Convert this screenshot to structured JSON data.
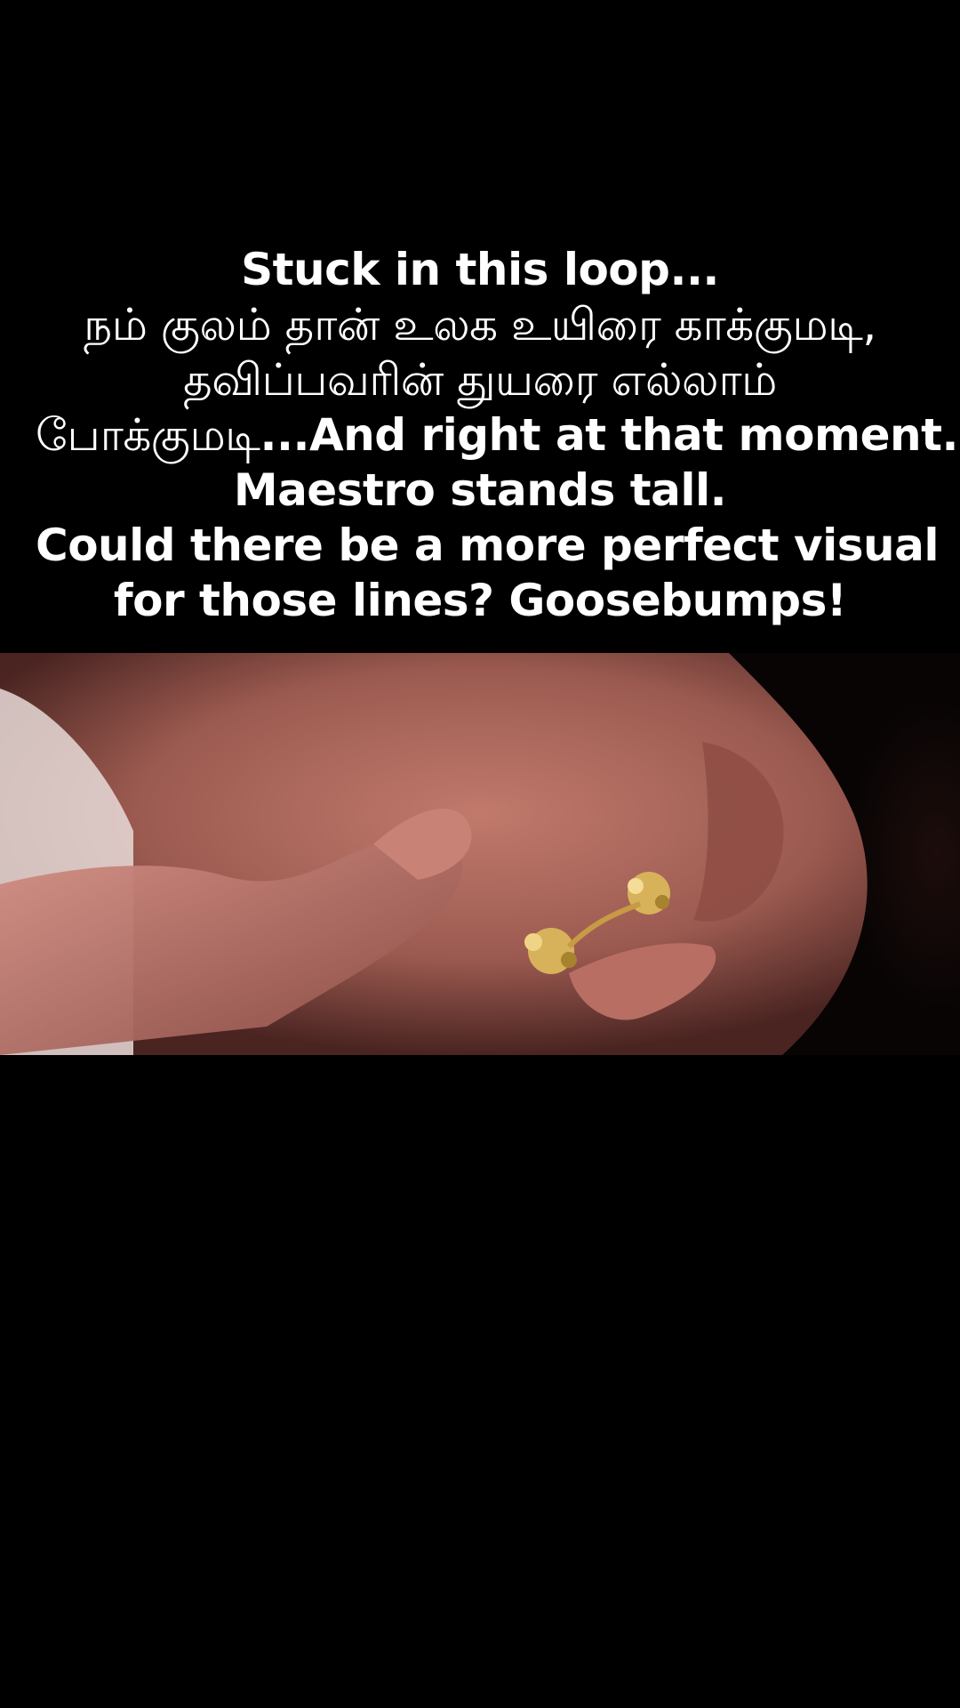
{
  "caption": {
    "line1": "Stuck in this loop...",
    "line2": "நம் குலம் தான் உலக உயிரை காக்குமடி,",
    "line3": "தவிப்பவரின் துயரை எல்லாம்",
    "line4_tamil": "போக்குமடி",
    "line4_english": "...And right at that moment...",
    "line5": "Maestro stands tall.",
    "line6": "Could there be a more perfect visual",
    "line7": "for those lines? Goosebumps!"
  },
  "video": {
    "accent_colors": {
      "skin": "#b76b5f",
      "gold": "#d8b25a",
      "shadow": "#1a0c0a"
    }
  }
}
